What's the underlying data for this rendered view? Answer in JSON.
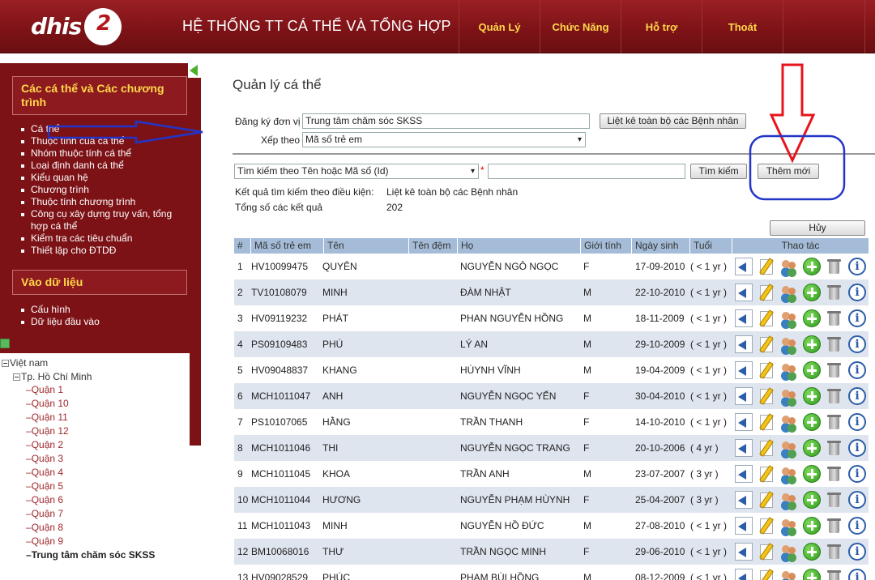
{
  "header": {
    "logo_text": "dhis",
    "logo_number": "2",
    "title": "HỆ THỐNG TT CÁ THỂ VÀ TỔNG HỢP",
    "nav": [
      "Quản Lý",
      "Chức Năng",
      "Hỗ trợ",
      "Thoát"
    ]
  },
  "sidebar": {
    "section1_title": "Các cá thể và Các chương trình",
    "section1_items": [
      "Cá thể",
      "Thuộc tính của cá thể",
      "Nhóm thuộc tính cá thể",
      "Loại định danh cá thể",
      "Kiểu quan hệ",
      "Chương trình",
      "Thuộc tính chương trình",
      "Công cụ xây dựng truy vấn, tổng hợp cá thể",
      "Kiểm tra các tiêu chuẩn",
      "Thiết lập cho ĐTDĐ"
    ],
    "section2_title": "Vào dữ liệu",
    "section2_items": [
      "Cấu hình",
      "Dữ liệu đầu vào"
    ]
  },
  "tree": {
    "root": "Việt nam",
    "city": "Tp. Hồ Chí Minh",
    "districts": [
      "Quận 1",
      "Quận 10",
      "Quận 11",
      "Quận 12",
      "Quận 2",
      "Quận 3",
      "Quận 4",
      "Quận 5",
      "Quận 6",
      "Quận 7",
      "Quận 8",
      "Quận 9"
    ],
    "selected": "Trung tâm chăm sóc SKSS"
  },
  "main": {
    "page_title": "Quản lý cá thể",
    "org_unit_label": "Đăng ký đơn vị",
    "org_unit_value": "Trung tâm chăm sóc SKSS",
    "list_all_button": "Liệt kê toàn bộ các Bệnh nhân",
    "sort_label": "Xếp theo",
    "sort_value": "Mã số trẻ em",
    "search_by_value": "Tìm kiếm theo Tên hoặc Mã số (Id)",
    "search_input_value": "",
    "search_button": "Tìm kiếm",
    "add_new_button": "Thêm mới",
    "result_condition_label": "Kết quả tìm kiếm theo điều kiện:",
    "result_condition_value": "Liệt kê toàn bộ các Bệnh nhân",
    "total_label": "Tổng số các kết quả",
    "total_value": "202",
    "cancel_button": "Hủy"
  },
  "table": {
    "headers": [
      "#",
      "Mã số trẻ em",
      "Tên",
      "Tên đệm",
      "Họ",
      "Giới tính",
      "Ngày sinh",
      "Tuổi",
      "Thao tác"
    ],
    "rows": [
      [
        "1",
        "HV10099475",
        "QUYÊN",
        "",
        "NGUYỄN NGÔ NGỌC",
        "F",
        "17-09-2010",
        "( < 1 yr )"
      ],
      [
        "2",
        "TV10108079",
        "MINH",
        "",
        "ĐÀM NHẬT",
        "M",
        "22-10-2010",
        "( < 1 yr )"
      ],
      [
        "3",
        "HV09119232",
        "PHÁT",
        "",
        "PHAN NGUYỄN HỒNG",
        "M",
        "18-11-2009",
        "( < 1 yr )"
      ],
      [
        "4",
        "PS09109483",
        "PHÚ",
        "",
        "LÝ AN",
        "M",
        "29-10-2009",
        "( < 1 yr )"
      ],
      [
        "5",
        "HV09048837",
        "KHANG",
        "",
        "HÙYNH VĨNH",
        "M",
        "19-04-2009",
        "( < 1 yr )"
      ],
      [
        "6",
        "MCH1011047",
        "ANH",
        "",
        "NGUYỄN NGỌC YẾN",
        "F",
        "30-04-2010",
        "( < 1 yr )"
      ],
      [
        "7",
        "PS10107065",
        "HẰNG",
        "",
        "TRẦN THANH",
        "F",
        "14-10-2010",
        "( < 1 yr )"
      ],
      [
        "8",
        "MCH1011046",
        "THI",
        "",
        "NGUYỄN NGỌC TRANG",
        "F",
        "20-10-2006",
        "( 4 yr )"
      ],
      [
        "9",
        "MCH1011045",
        "KHOA",
        "",
        "TRẦN ANH",
        "M",
        "23-07-2007",
        "( 3 yr )"
      ],
      [
        "10",
        "MCH1011044",
        "HƯƠNG",
        "",
        "NGUYỄN PHẠM HÙYNH",
        "F",
        "25-04-2007",
        "( 3 yr )"
      ],
      [
        "11",
        "MCH1011043",
        "MINH",
        "",
        "NGUYỄN HỒ ĐỨC",
        "M",
        "27-08-2010",
        "( < 1 yr )"
      ],
      [
        "12",
        "BM10068016",
        "THƯ",
        "",
        "TRẦN NGỌC MINH",
        "F",
        "29-06-2010",
        "( < 1 yr )"
      ],
      [
        "13",
        "HV09028529",
        "PHÚC",
        "",
        "PHAM BÙI HỒNG",
        "M",
        "08-12-2009",
        "( < 1 yr )"
      ]
    ]
  },
  "colors": {
    "header_bg": "#7c1216",
    "nav_text": "#ffd84a",
    "sidebar_bg": "#7c1216",
    "table_header_bg": "#a4bcd8",
    "row_alt_bg": "#dfe5ef",
    "annotation_red": "#e8131b",
    "annotation_blue": "#2235c8"
  }
}
